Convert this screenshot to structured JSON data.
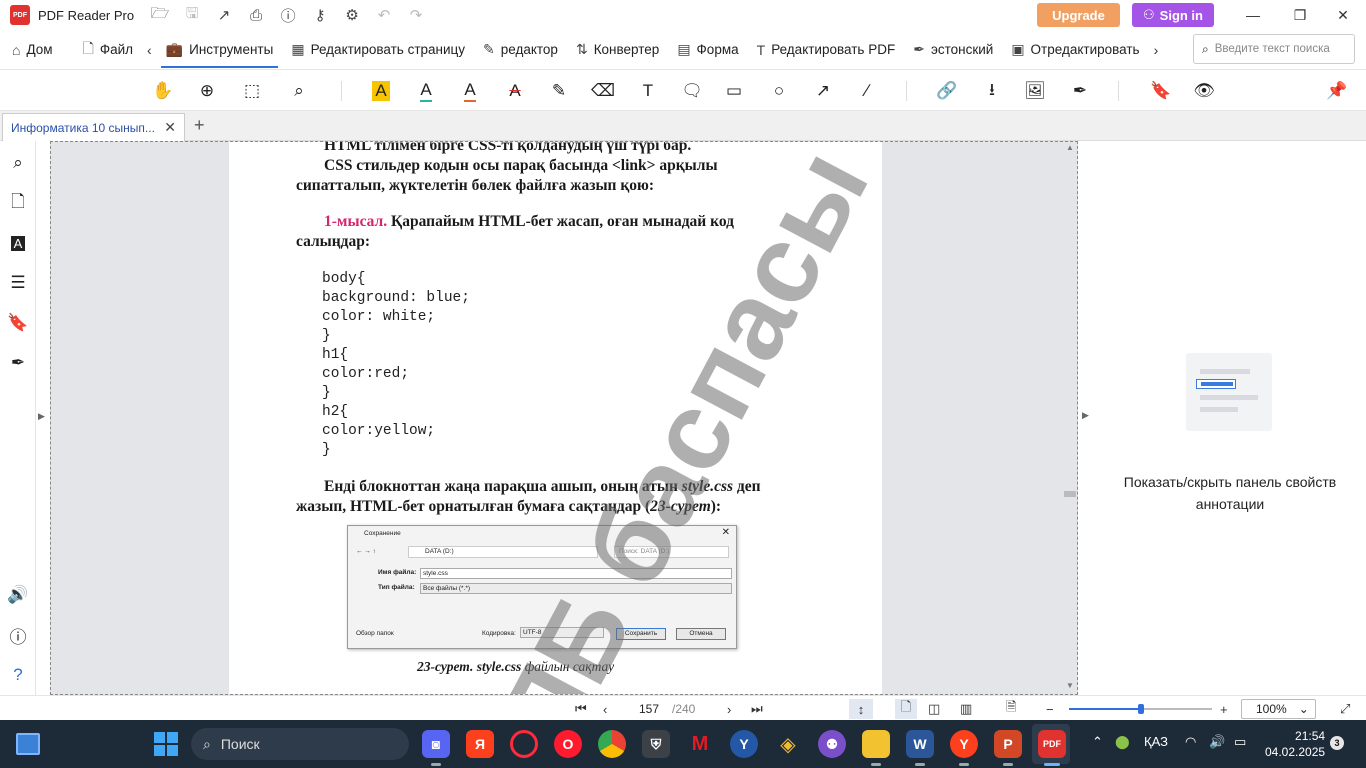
{
  "titlebar": {
    "app_name": "PDF Reader Pro",
    "logo_text": "PDF",
    "upgrade_label": "Upgrade",
    "signin_label": "Sign in",
    "icons": [
      "open-folder-icon",
      "save-icon",
      "share-icon",
      "print-icon",
      "help-icon",
      "key-icon",
      "settings-icon",
      "undo-icon",
      "redo-icon"
    ]
  },
  "menu": {
    "items": [
      {
        "label": "Дом",
        "icon": "home-icon"
      },
      {
        "label": "Файл",
        "icon": "file-icon"
      },
      {
        "label": "Инструменты",
        "icon": "toolbox-icon",
        "active": true
      },
      {
        "label": "Редактировать страницу",
        "icon": "grid-icon"
      },
      {
        "label": "редактор",
        "icon": "edit-icon"
      },
      {
        "label": "Конвертер",
        "icon": "convert-icon"
      },
      {
        "label": "Форма",
        "icon": "form-icon"
      },
      {
        "label": "Редактировать PDF",
        "icon": "text-edit-icon"
      },
      {
        "label": "эстонский",
        "icon": "sign-icon"
      },
      {
        "label": "Отредактировать",
        "icon": "redact-icon"
      }
    ],
    "search_placeholder": "Введите текст поиска"
  },
  "tabs": {
    "doc_tab": "Информатика 10 сынып..."
  },
  "page": {
    "line1": "HTML тілімен бірге CSS-ті қолданудың үш түрі бар.",
    "line2": "CSS стильдер кодын осы парақ басында <link> арқылы",
    "line3": "сипатталып, жүктелетін бөлек файлға жазып қою:",
    "example_label": "1-мысал.",
    "example_text1": " Қарапайым HTML-бет жасап, оған мынадай код",
    "example_text2": "салыңдар:",
    "code": [
      "body{",
      "background: blue;",
      "color: white;",
      "}",
      "h1{",
      "color:red;",
      "}",
      "h2{",
      "color:yellow;",
      "}"
    ],
    "para2_line1a": "Енді блокноттан жаңа парақша ашып, оның атын ",
    "para2_line1b": "style.css",
    "para2_line1c": " деп",
    "para2_line2a": "жазып, HTML-бет орнатылған бумаға сақтаңдар (",
    "para2_line2b": "23-сурет",
    "para2_line2c": "):",
    "watermark": "-ПБ баспасы",
    "caption_a": "23-сурет. style.css",
    "caption_b": " файлын сақтау",
    "figure": {
      "title": "Сохранение",
      "path": "DATA (D:)",
      "search": "Поиск: DATA (D:)",
      "filename_label": "Имя файла:",
      "filename_value": "style.css",
      "type_label": "Тип файла:",
      "type_value": "Все файлы (*.*)",
      "browse_folders": "Обзор папок",
      "encoding_label": "Кодировка:",
      "encoding_value": "UTF-8",
      "save_btn": "Сохранить",
      "cancel_btn": "Отмена"
    }
  },
  "right_panel": {
    "text": "Показать/скрыть панель свойств аннотации"
  },
  "status": {
    "current_page": "157",
    "total_pages": "/240",
    "zoom": "100%",
    "zoom_level": 0.5
  },
  "taskbar": {
    "search_label": "Поиск",
    "language": "ҚАЗ",
    "time": "21:54",
    "date": "04.02.2025",
    "notifications": "3",
    "apps": [
      "discord-app",
      "yandex-app",
      "opera-app",
      "opera-red-app",
      "chrome-app",
      "tanks-app",
      "m-app",
      "y-app",
      "binance-app",
      "game-app",
      "explorer-app",
      "word-app",
      "yandex-browser-app",
      "powerpoint-app",
      "pdf-reader-app"
    ]
  }
}
